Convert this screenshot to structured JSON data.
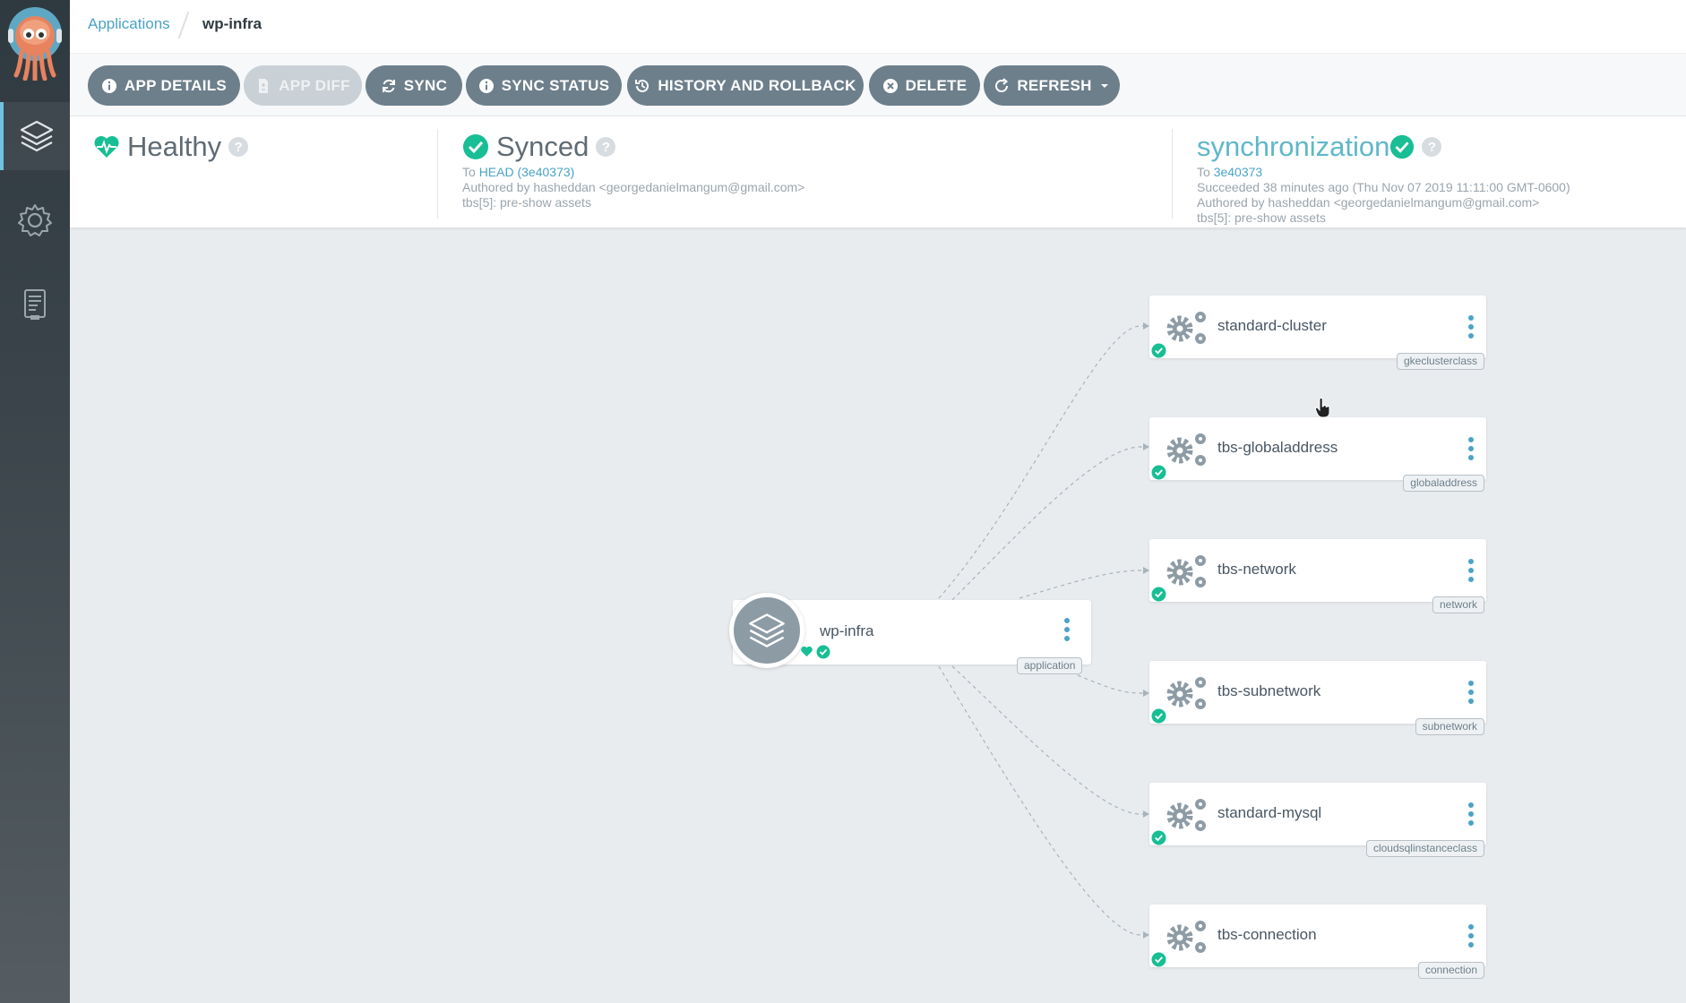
{
  "breadcrumb": {
    "parent": "Applications",
    "current": "wp-infra"
  },
  "toolbar": {
    "buttons": [
      {
        "label": "APP DETAILS",
        "icon": "info-icon"
      },
      {
        "label": "APP DIFF",
        "icon": "file-diff-icon"
      },
      {
        "label": "SYNC",
        "icon": "sync-icon"
      },
      {
        "label": "SYNC STATUS",
        "icon": "info-icon"
      },
      {
        "label": "HISTORY AND ROLLBACK",
        "icon": "history-icon"
      },
      {
        "label": "DELETE",
        "icon": "times-circle-icon"
      },
      {
        "label": "REFRESH",
        "icon": "refresh-icon"
      }
    ]
  },
  "status": {
    "health": {
      "label": "Healthy",
      "help": "?"
    },
    "sync": {
      "label": "Synced",
      "help": "?",
      "to_prefix": "To",
      "head_link": "HEAD (3e40373)",
      "author": "Authored by hasheddan <georgedanielmangum@gmail.com>",
      "message": "tbs[5]: pre-show assets"
    },
    "operation": {
      "label": "synchronization",
      "help": "?",
      "to_prefix": "To",
      "rev_link": "3e40373",
      "result": "Succeeded 38 minutes ago (Thu Nov 07 2019 11:11:00 GMT-0600)",
      "author": "Authored by hasheddan <georgedanielmangum@gmail.com>",
      "message": "tbs[5]: pre-show assets"
    }
  },
  "graph": {
    "app": {
      "name": "wp-infra",
      "kind": "application"
    },
    "resources": [
      {
        "name": "standard-cluster",
        "kind": "gkeclusterclass"
      },
      {
        "name": "tbs-globaladdress",
        "kind": "globaladdress"
      },
      {
        "name": "tbs-network",
        "kind": "network"
      },
      {
        "name": "tbs-subnetwork",
        "kind": "subnetwork"
      },
      {
        "name": "standard-mysql",
        "kind": "cloudsqlinstanceclass"
      },
      {
        "name": "tbs-connection",
        "kind": "connection"
      }
    ]
  },
  "colors": {
    "accent": "#4aa3c7",
    "healthy": "#18be94",
    "button": "#6d7f8b",
    "sidebar": "#2f3a40"
  }
}
